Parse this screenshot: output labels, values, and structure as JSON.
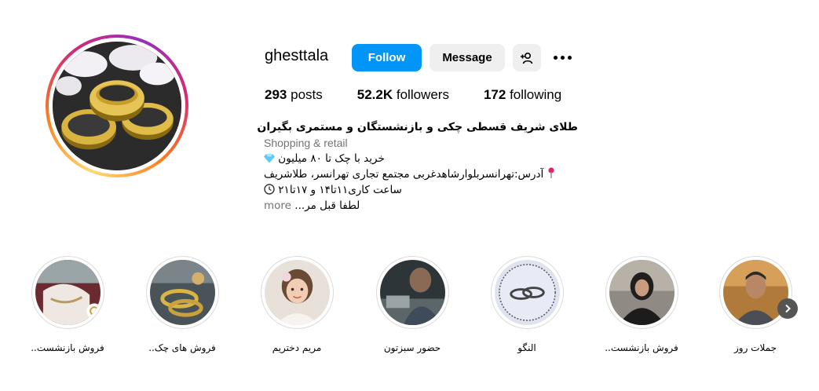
{
  "profile": {
    "username": "ghesttala",
    "follow_label": "Follow",
    "message_label": "Message",
    "stats": {
      "posts_count": "293",
      "posts_label": "posts",
      "followers_count": "52.2K",
      "followers_label": "followers",
      "following_count": "172",
      "following_label": "following"
    },
    "bio": {
      "name": "طلای شریف قسطی چکی و بازنشستگان و مستمری بگیران",
      "category": "Shopping & retail",
      "line1": "خرید با چک تا ۸۰ میلیون",
      "line2": "آدرس:تهرانسربلوارشاهدغربی مجتمع تجاری تهرانسر، طلاشریف",
      "line3": "ساعت کاری۱۱تا۱۴ و ۱۷تا۲۱",
      "line4": "لطفا قبل مر...",
      "more": "more"
    }
  },
  "highlights": [
    {
      "label": "فروش بازنشست..",
      "icon": "jewelry-bag-photo"
    },
    {
      "label": "فروش های چک..",
      "icon": "bangles-photo"
    },
    {
      "label": "مریم دختریم",
      "icon": "child-photo"
    },
    {
      "label": "حضور سبزتون",
      "icon": "customer-photo"
    },
    {
      "label": "النگو",
      "icon": "rings-logo"
    },
    {
      "label": "فروش بازنشست..",
      "icon": "woman-photo"
    },
    {
      "label": "جملات روز",
      "icon": "man-photo"
    }
  ],
  "colors": {
    "follow_bg": "#0095f6",
    "secondary_bg": "#efefef",
    "muted_text": "#737373"
  }
}
